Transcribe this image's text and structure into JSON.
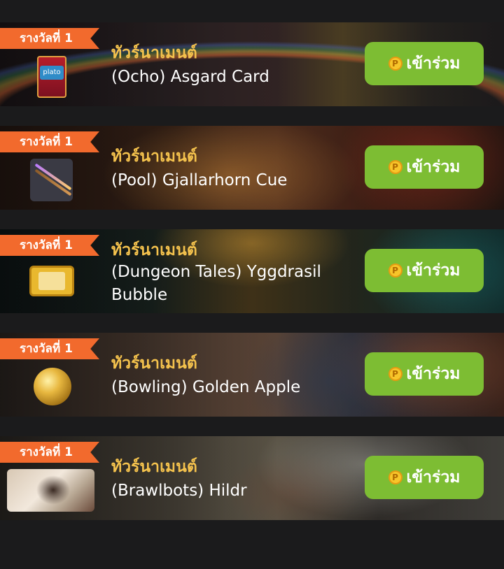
{
  "tournaments": [
    {
      "badge": "รางวัลที่ 1",
      "title": "ทัวร์นาเมนต์",
      "name": "(Ocho) Asgard Card",
      "thumb_icon": "plato-card-icon",
      "thumb_label": "plato",
      "button_label": "เข้าร่วม"
    },
    {
      "badge": "รางวัลที่ 1",
      "title": "ทัวร์นาเมนต์",
      "name": "(Pool) Gjallarhorn Cue",
      "thumb_icon": "pool-cue-icon",
      "button_label": "เข้าร่วม"
    },
    {
      "badge": "รางวัลที่ 1",
      "title": "ทัวร์นาเมนต์",
      "name": "(Dungeon Tales) Yggdrasil Bubble",
      "thumb_icon": "golden-scroll-icon",
      "button_label": "เข้าร่วม"
    },
    {
      "badge": "รางวัลที่ 1",
      "title": "ทัวร์นาเมนต์",
      "name": "(Bowling) Golden Apple",
      "thumb_icon": "golden-apple-icon",
      "button_label": "เข้าร่วม"
    },
    {
      "badge": "รางวัลที่ 1",
      "title": "ทัวร์นาเมนต์",
      "name": "(Brawlbots) Hildr",
      "thumb_icon": "hildr-portrait-icon",
      "button_label": "เข้าร่วม"
    }
  ],
  "coin_icon": "coin-icon",
  "coin_glyph": "P",
  "colors": {
    "background": "#1b1b1c",
    "ribbon": "#f26a2d",
    "title": "#f4c24d",
    "button": "#7dbd33",
    "coin": "#f7c52a"
  }
}
